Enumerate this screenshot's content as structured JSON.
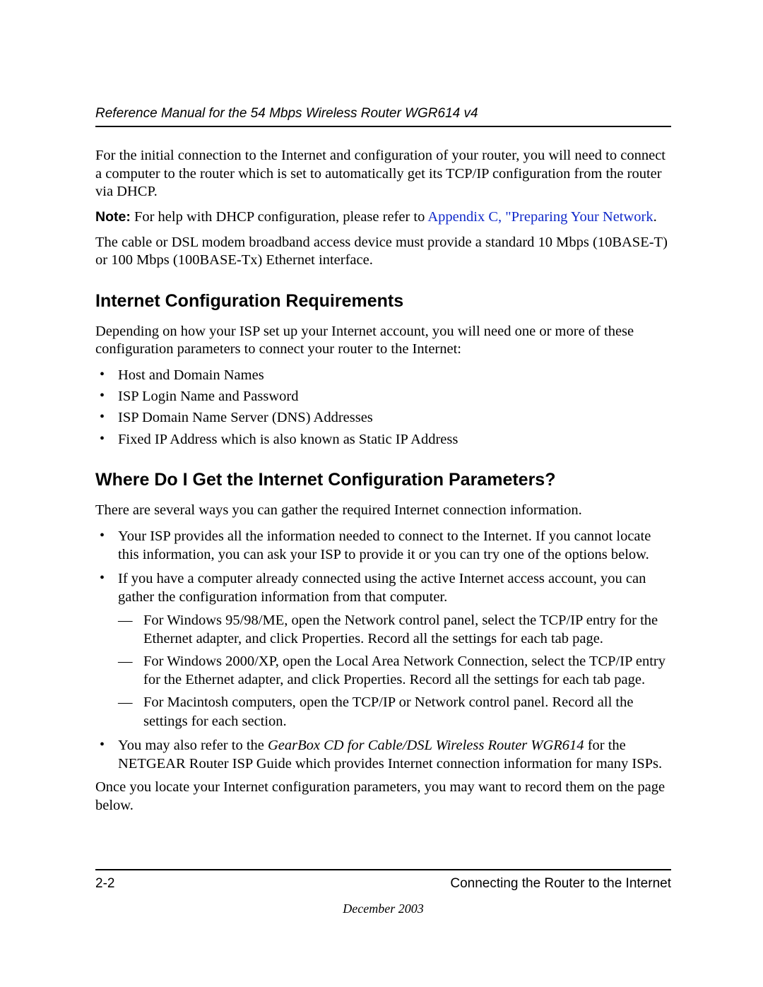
{
  "header": {
    "title": "Reference Manual for the 54 Mbps Wireless Router WGR614 v4"
  },
  "paragraphs": {
    "intro": "For the initial connection to the Internet and configuration of your router, you will need to connect a computer to the router which is set to automatically get its TCP/IP configuration from the router via DHCP.",
    "note_label": "Note:",
    "note_text": " For help with DHCP configuration, please refer to ",
    "note_link": "Appendix C, \"Preparing Your Network",
    "note_tail": ".",
    "modem": "The cable or DSL modem broadband access device must provide a standard 10 Mbps (10BASE-T) or 100 Mbps (100BASE-Tx) Ethernet interface."
  },
  "section1": {
    "heading": "Internet Configuration Requirements",
    "intro": "Depending on how your ISP set up your Internet account, you will need one or more of these configuration parameters to connect your router to the Internet:",
    "items": [
      "Host and Domain Names",
      "ISP Login Name and Password",
      "ISP Domain Name Server (DNS) Addresses",
      "Fixed IP Address which is also known as Static IP Address"
    ]
  },
  "section2": {
    "heading": "Where Do I Get the Internet Configuration Parameters?",
    "intro": "There are several ways you can gather the required Internet connection information.",
    "items": {
      "a": "Your ISP provides all the information needed to connect to the Internet. If you cannot locate this information, you can ask your ISP to provide it or you can try one of the options below.",
      "b": "If you have a computer already connected using the active Internet access account, you can gather the configuration information from that computer.",
      "b_sub": [
        "For Windows 95/98/ME, open the Network control panel, select the TCP/IP entry for the Ethernet adapter, and click Properties. Record all the settings for each tab page.",
        "For Windows 2000/XP, open the Local Area Network Connection, select the TCP/IP entry for the Ethernet adapter, and click Properties. Record all the settings for each tab page.",
        "For Macintosh computers, open the TCP/IP or Network control panel. Record all the settings for each section."
      ],
      "c_pre": "You may also refer to the ",
      "c_italic": "GearBox CD for Cable/DSL Wireless Router WGR614",
      "c_post": " for the NETGEAR Router ISP Guide which provides Internet connection information for many ISPs."
    },
    "outro": "Once you locate your Internet configuration parameters, you may want to record them on the page below."
  },
  "footer": {
    "page": "2-2",
    "chapter": "Connecting the Router to the Internet",
    "date": "December 2003"
  }
}
